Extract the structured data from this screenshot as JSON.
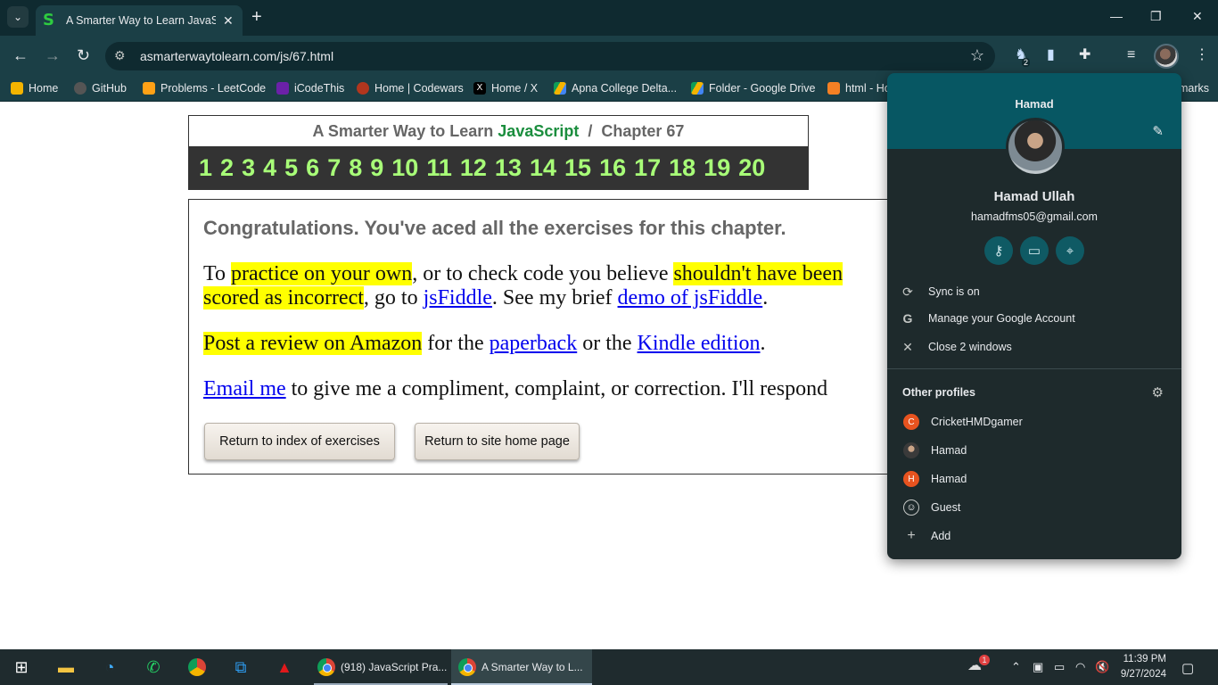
{
  "browser": {
    "tab_title": "A Smarter Way to Learn JavaScri",
    "tab_favicon": "S",
    "url": "asmarterwaytolearn.com/js/67.html",
    "extension_badge": "2",
    "bookmarks": [
      {
        "label": "Home",
        "icon": "home-bookmark-icon",
        "color": "#f4b400"
      },
      {
        "label": "GitHub",
        "icon": "github-icon",
        "color": "#333333"
      },
      {
        "label": "Problems - LeetCode",
        "icon": "leetcode-icon",
        "color": "#ffa116"
      },
      {
        "label": "iCodeThis",
        "icon": "icodethis-icon",
        "color": "#6b21a8"
      },
      {
        "label": "Home | Codewars",
        "icon": "codewars-icon",
        "color": "#b1361e"
      },
      {
        "label": "Home / X",
        "icon": "x-icon",
        "color": "#000000"
      },
      {
        "label": "Apna College Delta...",
        "icon": "google-drive-icon",
        "color": "#0f9d58"
      },
      {
        "label": "Folder - Google Drive",
        "icon": "google-drive-icon",
        "color": "#0f9d58"
      },
      {
        "label": "html - Ho",
        "icon": "stackoverflow-icon",
        "color": "#f48024"
      }
    ],
    "bookmarks_overflow": "marks"
  },
  "page": {
    "header_prefix": "A Smarter Way to Learn",
    "header_js": "JavaScript",
    "header_sep": "/",
    "header_chapter": "Chapter 67",
    "chapter_numbers": [
      "1",
      "2",
      "3",
      "4",
      "5",
      "6",
      "7",
      "8",
      "9",
      "10",
      "11",
      "12",
      "13",
      "14",
      "15",
      "16",
      "17",
      "18",
      "19",
      "20"
    ],
    "congrats": "Congratulations. You've aced all the exercises for this chapter.",
    "p1": {
      "t1": "To ",
      "hl1": "practice on your own",
      "t2": ", or to check code you believe ",
      "hl2": "shouldn't have been",
      "hl3": "scored as incorrect",
      "t3": ", go to ",
      "link1": "jsFiddle",
      "t4": ". See my brief ",
      "link2": "demo of jsFiddle",
      "t5": "."
    },
    "p2": {
      "hl": "Post a review on Amazon",
      "t1": " for the ",
      "link1": "paperback",
      "t2": " or the ",
      "link2": "Kindle edition",
      "t3": "."
    },
    "p3": {
      "link": "Email me",
      "t1": " to give me a compliment, complaint, or correction. I'll respond"
    },
    "btn_index": "Return to index of exercises",
    "btn_home": "Return to site home page"
  },
  "profile_menu": {
    "header_name": "Hamad",
    "full_name": "Hamad Ullah",
    "email": "hamadfms05@gmail.com",
    "actions": [
      {
        "label": "Sync is on",
        "icon": "sync-icon"
      },
      {
        "label": "Manage your Google Account",
        "icon": "google-g-icon"
      },
      {
        "label": "Close 2 windows",
        "icon": "close-icon"
      }
    ],
    "other_profiles_label": "Other profiles",
    "profiles": [
      {
        "label": "CricketHMDgamer",
        "initial": "C",
        "color": "#e8531f"
      },
      {
        "label": "Hamad",
        "initial": "",
        "color": "#8a8f93"
      },
      {
        "label": "Hamad",
        "initial": "H",
        "color": "#e8531f"
      },
      {
        "label": "Guest",
        "initial": "",
        "color": "transparent"
      },
      {
        "label": "Add",
        "initial": "+",
        "color": "transparent"
      }
    ]
  },
  "taskbar": {
    "apps": [
      {
        "label": "(918) JavaScript Pra..."
      },
      {
        "label": "A Smarter Way to L..."
      }
    ],
    "weather_badge": "1",
    "time": "11:39 PM",
    "date": "9/27/2024"
  }
}
